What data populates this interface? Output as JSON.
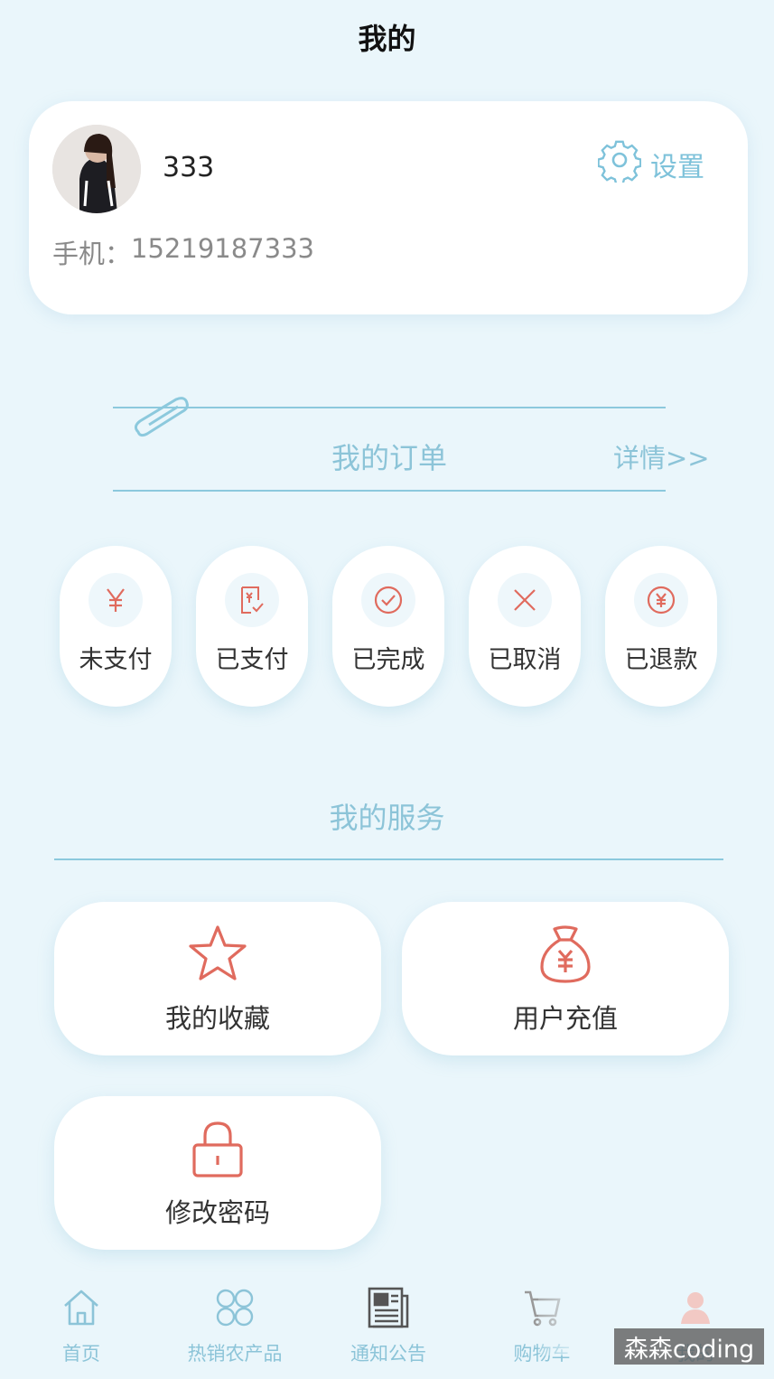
{
  "header": {
    "title": "我的"
  },
  "profile": {
    "username": "333",
    "settings_label": "设置",
    "phone_label": "手机：",
    "phone_value": "15219187333"
  },
  "orders": {
    "title": "我的订单",
    "detail_link": "详情>>",
    "statuses": [
      {
        "label": "未支付",
        "icon": "yen-icon"
      },
      {
        "label": "已支付",
        "icon": "receipt-icon"
      },
      {
        "label": "已完成",
        "icon": "check-circle-icon"
      },
      {
        "label": "已取消",
        "icon": "close-icon"
      },
      {
        "label": "已退款",
        "icon": "refund-icon"
      }
    ]
  },
  "services": {
    "title": "我的服务",
    "items": [
      {
        "label": "我的收藏",
        "icon": "star-icon"
      },
      {
        "label": "用户充值",
        "icon": "money-bag-icon"
      },
      {
        "label": "修改密码",
        "icon": "lock-icon"
      }
    ]
  },
  "tabbar": {
    "items": [
      {
        "label": "首页",
        "icon": "home-icon"
      },
      {
        "label": "热销农产品",
        "icon": "grid-icon"
      },
      {
        "label": "通知公告",
        "icon": "news-icon"
      },
      {
        "label": "购物车",
        "icon": "cart-icon"
      },
      {
        "label": "我的",
        "icon": "user-icon"
      }
    ]
  },
  "watermark": "森森coding",
  "colors": {
    "accent": "#8cc4d8",
    "icon_red": "#e06b5e",
    "background": "#eaf6fb"
  }
}
